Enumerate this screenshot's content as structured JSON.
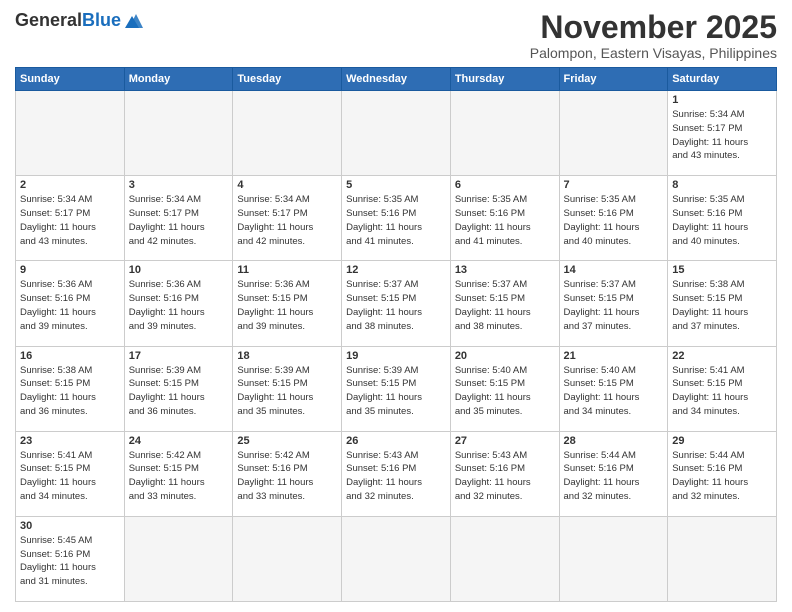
{
  "header": {
    "logo_general": "General",
    "logo_blue": "Blue",
    "month_title": "November 2025",
    "location": "Palompon, Eastern Visayas, Philippines"
  },
  "weekdays": [
    "Sunday",
    "Monday",
    "Tuesday",
    "Wednesday",
    "Thursday",
    "Friday",
    "Saturday"
  ],
  "weeks": [
    [
      {
        "day": "",
        "info": ""
      },
      {
        "day": "",
        "info": ""
      },
      {
        "day": "",
        "info": ""
      },
      {
        "day": "",
        "info": ""
      },
      {
        "day": "",
        "info": ""
      },
      {
        "day": "",
        "info": ""
      },
      {
        "day": "1",
        "info": "Sunrise: 5:34 AM\nSunset: 5:17 PM\nDaylight: 11 hours\nand 43 minutes."
      }
    ],
    [
      {
        "day": "2",
        "info": "Sunrise: 5:34 AM\nSunset: 5:17 PM\nDaylight: 11 hours\nand 43 minutes."
      },
      {
        "day": "3",
        "info": "Sunrise: 5:34 AM\nSunset: 5:17 PM\nDaylight: 11 hours\nand 42 minutes."
      },
      {
        "day": "4",
        "info": "Sunrise: 5:34 AM\nSunset: 5:17 PM\nDaylight: 11 hours\nand 42 minutes."
      },
      {
        "day": "5",
        "info": "Sunrise: 5:35 AM\nSunset: 5:16 PM\nDaylight: 11 hours\nand 41 minutes."
      },
      {
        "day": "6",
        "info": "Sunrise: 5:35 AM\nSunset: 5:16 PM\nDaylight: 11 hours\nand 41 minutes."
      },
      {
        "day": "7",
        "info": "Sunrise: 5:35 AM\nSunset: 5:16 PM\nDaylight: 11 hours\nand 40 minutes."
      },
      {
        "day": "8",
        "info": "Sunrise: 5:35 AM\nSunset: 5:16 PM\nDaylight: 11 hours\nand 40 minutes."
      }
    ],
    [
      {
        "day": "9",
        "info": "Sunrise: 5:36 AM\nSunset: 5:16 PM\nDaylight: 11 hours\nand 39 minutes."
      },
      {
        "day": "10",
        "info": "Sunrise: 5:36 AM\nSunset: 5:16 PM\nDaylight: 11 hours\nand 39 minutes."
      },
      {
        "day": "11",
        "info": "Sunrise: 5:36 AM\nSunset: 5:15 PM\nDaylight: 11 hours\nand 39 minutes."
      },
      {
        "day": "12",
        "info": "Sunrise: 5:37 AM\nSunset: 5:15 PM\nDaylight: 11 hours\nand 38 minutes."
      },
      {
        "day": "13",
        "info": "Sunrise: 5:37 AM\nSunset: 5:15 PM\nDaylight: 11 hours\nand 38 minutes."
      },
      {
        "day": "14",
        "info": "Sunrise: 5:37 AM\nSunset: 5:15 PM\nDaylight: 11 hours\nand 37 minutes."
      },
      {
        "day": "15",
        "info": "Sunrise: 5:38 AM\nSunset: 5:15 PM\nDaylight: 11 hours\nand 37 minutes."
      }
    ],
    [
      {
        "day": "16",
        "info": "Sunrise: 5:38 AM\nSunset: 5:15 PM\nDaylight: 11 hours\nand 36 minutes."
      },
      {
        "day": "17",
        "info": "Sunrise: 5:39 AM\nSunset: 5:15 PM\nDaylight: 11 hours\nand 36 minutes."
      },
      {
        "day": "18",
        "info": "Sunrise: 5:39 AM\nSunset: 5:15 PM\nDaylight: 11 hours\nand 35 minutes."
      },
      {
        "day": "19",
        "info": "Sunrise: 5:39 AM\nSunset: 5:15 PM\nDaylight: 11 hours\nand 35 minutes."
      },
      {
        "day": "20",
        "info": "Sunrise: 5:40 AM\nSunset: 5:15 PM\nDaylight: 11 hours\nand 35 minutes."
      },
      {
        "day": "21",
        "info": "Sunrise: 5:40 AM\nSunset: 5:15 PM\nDaylight: 11 hours\nand 34 minutes."
      },
      {
        "day": "22",
        "info": "Sunrise: 5:41 AM\nSunset: 5:15 PM\nDaylight: 11 hours\nand 34 minutes."
      }
    ],
    [
      {
        "day": "23",
        "info": "Sunrise: 5:41 AM\nSunset: 5:15 PM\nDaylight: 11 hours\nand 34 minutes."
      },
      {
        "day": "24",
        "info": "Sunrise: 5:42 AM\nSunset: 5:15 PM\nDaylight: 11 hours\nand 33 minutes."
      },
      {
        "day": "25",
        "info": "Sunrise: 5:42 AM\nSunset: 5:16 PM\nDaylight: 11 hours\nand 33 minutes."
      },
      {
        "day": "26",
        "info": "Sunrise: 5:43 AM\nSunset: 5:16 PM\nDaylight: 11 hours\nand 32 minutes."
      },
      {
        "day": "27",
        "info": "Sunrise: 5:43 AM\nSunset: 5:16 PM\nDaylight: 11 hours\nand 32 minutes."
      },
      {
        "day": "28",
        "info": "Sunrise: 5:44 AM\nSunset: 5:16 PM\nDaylight: 11 hours\nand 32 minutes."
      },
      {
        "day": "29",
        "info": "Sunrise: 5:44 AM\nSunset: 5:16 PM\nDaylight: 11 hours\nand 32 minutes."
      }
    ],
    [
      {
        "day": "30",
        "info": "Sunrise: 5:45 AM\nSunset: 5:16 PM\nDaylight: 11 hours\nand 31 minutes."
      },
      {
        "day": "",
        "info": ""
      },
      {
        "day": "",
        "info": ""
      },
      {
        "day": "",
        "info": ""
      },
      {
        "day": "",
        "info": ""
      },
      {
        "day": "",
        "info": ""
      },
      {
        "day": "",
        "info": ""
      }
    ]
  ]
}
